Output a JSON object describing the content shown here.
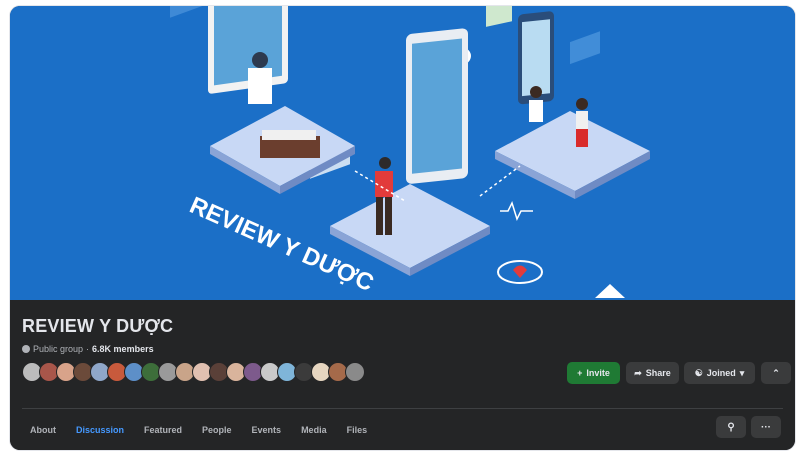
{
  "cover": {
    "image_label": "REVIEW Y DƯỢC",
    "background_color": "#1b6fc7"
  },
  "group": {
    "name": "REVIEW Y DƯỢC",
    "privacy": "Public group",
    "separator": "·",
    "members": "6.8K members"
  },
  "actions": {
    "invite": "Invite",
    "share": "Share",
    "joined": "Joined"
  },
  "tabs": [
    {
      "label": "About"
    },
    {
      "label": "Discussion",
      "active": true
    },
    {
      "label": "Featured"
    },
    {
      "label": "People"
    },
    {
      "label": "Events"
    },
    {
      "label": "Media"
    },
    {
      "label": "Files"
    }
  ],
  "avatars": [
    {
      "color": "#bcbcbc"
    },
    {
      "color": "#a8564a"
    },
    {
      "color": "#d8a38a"
    },
    {
      "color": "#6b4a3a"
    },
    {
      "color": "#8fa7c9"
    },
    {
      "color": "#c85a3c"
    },
    {
      "color": "#5d8fc8"
    },
    {
      "color": "#3d6e3a"
    },
    {
      "color": "#9a9a9a"
    },
    {
      "color": "#c9a489"
    },
    {
      "color": "#e0c0b0"
    },
    {
      "color": "#5a4038"
    },
    {
      "color": "#d9b49c"
    },
    {
      "color": "#7d5a8c"
    },
    {
      "color": "#c9c9c9"
    },
    {
      "color": "#7fb5d9"
    },
    {
      "color": "#3b3b3b"
    },
    {
      "color": "#e6d6c0"
    },
    {
      "color": "#a56a4a"
    },
    {
      "color": "#8a8a8a"
    }
  ],
  "icons": {
    "globe": "globe-icon",
    "plus": "plus-icon",
    "share": "share-icon",
    "joined": "joined-icon",
    "caret": "caret-down-icon",
    "collapse": "chevron-up-icon",
    "search": "search-icon",
    "more": "more-icon"
  },
  "colors": {
    "accent": "#4599ff",
    "invite_bg": "#1f7a34",
    "panel_bg": "#242526",
    "button_bg": "#3a3b3c"
  }
}
